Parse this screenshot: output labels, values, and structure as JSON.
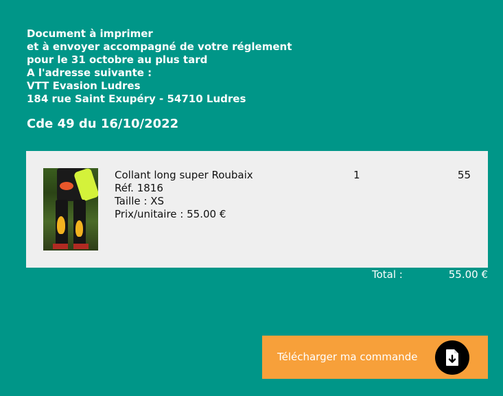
{
  "instructions": {
    "line1": "Document à imprimer",
    "line2": "et à envoyer accompagné de votre réglement",
    "line3": "pour le 31 octobre au plus tard",
    "line4": "A l'adresse suivante :",
    "line5": "VTT Evasion Ludres",
    "line6": "184 rue Saint Exupéry - 54710 Ludres"
  },
  "order": {
    "title": "Cde 49 du 16/10/2022"
  },
  "item": {
    "image_icon": "product-photo-cycling-tights",
    "name": "Collant long super Roubaix",
    "reference": "Réf. 1816",
    "size": "Taille : XS",
    "unit_price": "Prix/unitaire : 55.00 €",
    "quantity": "1",
    "line_total": "55"
  },
  "totals": {
    "label": "Total :",
    "value": "55.00 €"
  },
  "download": {
    "label": "Télécharger ma commande",
    "icon": "file-download-icon"
  },
  "colors": {
    "background": "#009688",
    "panel": "#efefef",
    "button": "#f7a03a",
    "icon_circle": "#000000"
  }
}
